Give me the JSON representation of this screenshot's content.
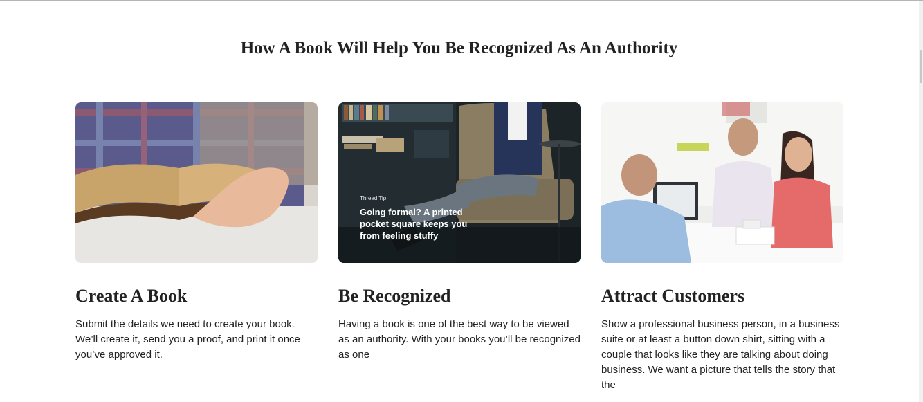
{
  "page": {
    "title": "How A Book Will Help You Be Recognized As An Authority"
  },
  "cards": [
    {
      "title": "Create A Book",
      "body": "Submit the details we need to create your book. We’ll create it, send you a proof, and print it once you’ve approved it.",
      "image": "open-book-in-hands"
    },
    {
      "title": "Be Recognized",
      "body": "Having a book is one of the best way to be viewed as an authority. With your books you’ll be recognized as one",
      "image": "man-in-armchair-library",
      "image_caption_tag": "Thread Tip",
      "image_caption": "Going formal? A printed pocket square keeps you from feeling stuffy"
    },
    {
      "title": "Attract Customers",
      "body": "Show a professional business person, in a business suite or at least a button down shirt, sitting with a couple that looks like they are talking about doing business. We want a picture that tells the story that the",
      "image": "business-meeting-couple"
    }
  ]
}
